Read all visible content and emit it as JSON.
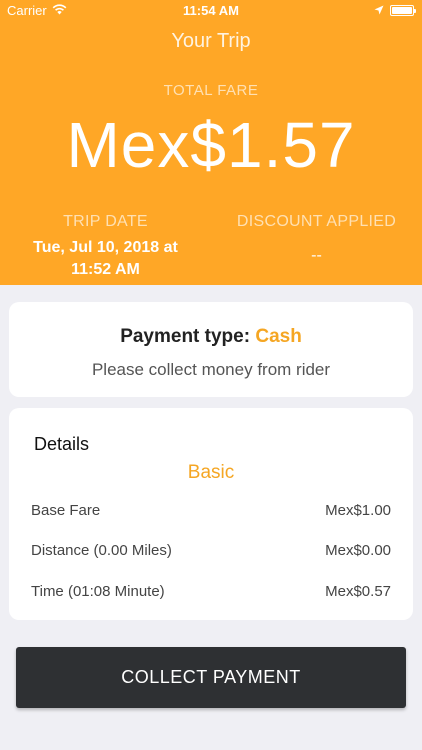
{
  "status_bar": {
    "carrier": "Carrier",
    "time": "11:54 AM"
  },
  "header": {
    "title": "Your Trip",
    "fare_label": "TOTAL FARE",
    "fare_amount": "Mex$1.57",
    "trip_date_label": "TRIP DATE",
    "trip_date_value_line1": "Tue, Jul 10, 2018 at",
    "trip_date_value_line2": "11:52 AM",
    "discount_label": "DISCOUNT APPLIED",
    "discount_value": "--"
  },
  "payment": {
    "label": "Payment type:",
    "type": "Cash",
    "note": "Please collect money from rider"
  },
  "details": {
    "title": "Details",
    "subtitle": "Basic",
    "rows": [
      {
        "label": "Base Fare",
        "value": "Mex$1.00"
      },
      {
        "label": "Distance (0.00 Miles)",
        "value": "Mex$0.00"
      },
      {
        "label": "Time (01:08 Minute)",
        "value": "Mex$0.57"
      }
    ]
  },
  "actions": {
    "collect_label": "COLLECT PAYMENT"
  },
  "colors": {
    "header_bg": "#FFA726",
    "accent": "#F5A623",
    "button_bg": "#2E3033"
  },
  "icons": [
    "wifi-icon",
    "location-arrow-icon",
    "battery-icon"
  ]
}
